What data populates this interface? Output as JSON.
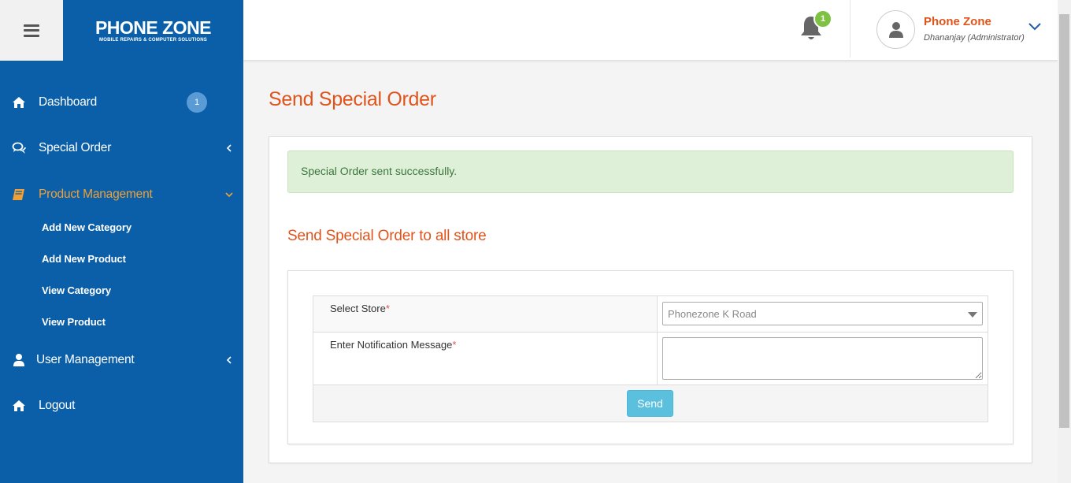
{
  "brand": {
    "name": "PHONE ZONE",
    "tagline": "MOBILE REPAIRS & COMPUTER SOLUTIONS",
    "color": "#0a5fa8"
  },
  "header": {
    "notification_count": "1",
    "user_name": "Phone Zone",
    "user_role": "Dhananjay (Administrator)"
  },
  "sidebar": {
    "items": [
      {
        "label": "Dashboard",
        "icon": "home-icon",
        "badge": "1"
      },
      {
        "label": "Special Order",
        "icon": "comments-icon"
      },
      {
        "label": "Product Management",
        "icon": "book-icon",
        "active": true,
        "children": [
          "Add New Category",
          "Add New Product",
          "View Category",
          "View Product"
        ]
      },
      {
        "label": "User Management",
        "icon": "user-icon"
      },
      {
        "label": "Logout",
        "icon": "home-icon"
      }
    ]
  },
  "main": {
    "title": "Send Special Order",
    "alert": "Special Order sent successfully.",
    "section_title": "Send Special Order to all store",
    "form": {
      "store_label": "Select Store",
      "store_value": "Phonezone K Road",
      "message_label": "Enter Notification Message",
      "required_mark": "*",
      "send_label": "Send"
    }
  },
  "colors": {
    "accent": "#e0541b",
    "sidebar": "#0a5fa8",
    "success_bg": "#dff0d8",
    "button": "#5bc0de"
  }
}
